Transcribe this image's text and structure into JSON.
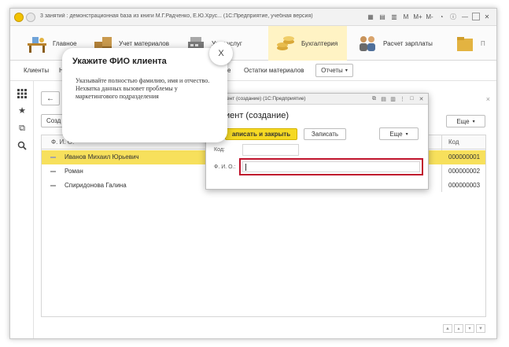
{
  "window": {
    "title": "3 занятий : демонстрационная база из книги М.Г.Радченко, Е.Ю.Хрус... (1С:Предприятие, учебная версия)",
    "buttons": [
      "M",
      "M+",
      "M-"
    ]
  },
  "sections": [
    {
      "label": "Главное",
      "icon": "desk-icon"
    },
    {
      "label": "Учет материалов",
      "icon": "boxes-icon"
    },
    {
      "label": "Учет услуг",
      "icon": "register-icon"
    },
    {
      "label": "Бухгалтерия",
      "icon": "coins-icon"
    },
    {
      "label": "Расчет зарплаты",
      "icon": "people-icon"
    },
    {
      "label": "П",
      "icon": "folder-icon"
    }
  ],
  "nav": {
    "items": [
      "Клиенты",
      "Н",
      "е",
      "Остатки материалов"
    ],
    "reports_label": "Отчеты"
  },
  "list": {
    "create_label": "Созд",
    "more_label": "Еще",
    "columns": {
      "name": "Ф. И. О.",
      "code": "Код"
    },
    "rows": [
      {
        "name": "Иванов Михаил Юрьевич",
        "code": "000000001",
        "selected": true
      },
      {
        "name": "Роман",
        "code": "000000002",
        "selected": false
      },
      {
        "name": "Спиридонова Галина",
        "code": "000000003",
        "selected": false
      }
    ]
  },
  "dialog": {
    "title": "ент (создание)  (1С:Предприятие)",
    "heading": "иент (создание)",
    "save_close_label": "аписать и закрыть",
    "save_label": "Записать",
    "more_label": "Еще",
    "code_label": "Код:",
    "fio_label": "Ф. И. О.:",
    "fio_value": ""
  },
  "tooltip": {
    "title": "Укажите ФИО клиента",
    "body": "Указывайте полностью фамилию, имя и отчество. Нехватка данных вызовет проблемы у маркетингового подразделения",
    "close_label": "X"
  }
}
